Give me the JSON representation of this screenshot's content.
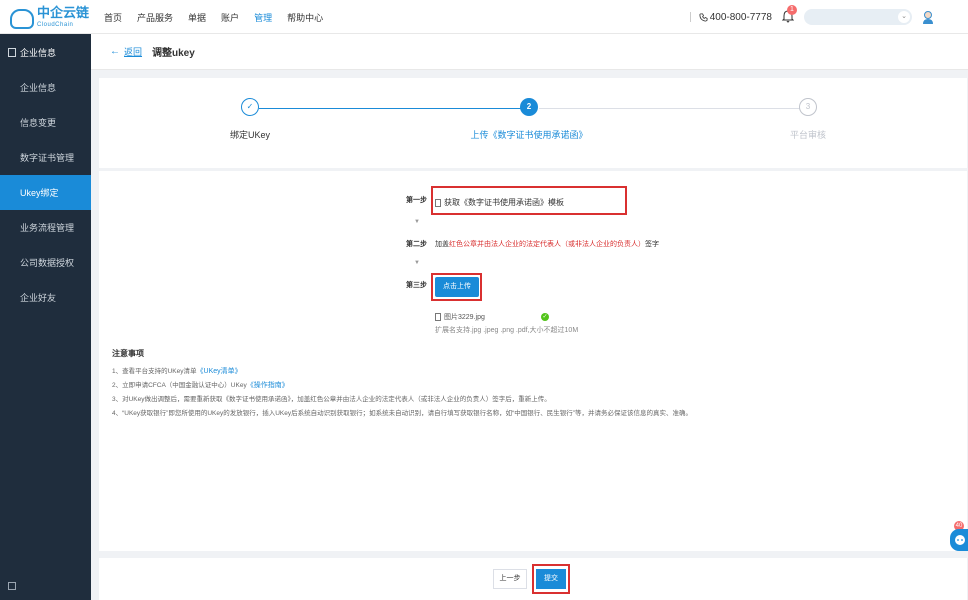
{
  "brand": {
    "name": "中企云链",
    "sub": "CloudChain"
  },
  "nav": {
    "items": [
      "首页",
      "产品服务",
      "单据",
      "账户",
      "管理",
      "帮助中心"
    ],
    "active_index": 4
  },
  "topbar": {
    "phone": "400-800-7778",
    "notification_count": "1",
    "company_select_value": ""
  },
  "sidebar": {
    "header": "企业信息",
    "items": [
      "企业信息",
      "信息变更",
      "数字证书管理",
      "Ukey绑定",
      "业务流程管理",
      "公司数据授权",
      "企业好友"
    ],
    "active_index": 3
  },
  "page": {
    "back_label": "返回",
    "title": "调整ukey"
  },
  "steps": [
    {
      "num": "1",
      "label": "绑定UKey",
      "status": "done"
    },
    {
      "num": "2",
      "label": "上传《数字证书使用承诺函》",
      "status": "active"
    },
    {
      "num": "3",
      "label": "平台审核",
      "status": "pending"
    }
  ],
  "upload": {
    "step1_label": "第一步",
    "step1_link": "获取《数字证书使用承诺函》模板",
    "step2_label": "第二步",
    "step2_pre": "加盖",
    "step2_red": "红色公章并由法人企业的法定代表人（或非法人企业的负责人）",
    "step2_post": "签字",
    "step3_label": "第三步",
    "upload_button": "点击上传",
    "file_name": "图片3229.jpg",
    "hint": "扩展名支持.jpg .jpeg .png .pdf,大小不超过10M"
  },
  "notes": {
    "title": "注意事项",
    "n1_text": "1、查看平台支持的UKey清单",
    "n1_link": "《UKey清单》",
    "n2_text": "2、立即申请CFCA（中国金融认证中心）UKey",
    "n2_link": "《操作指南》",
    "n3": "3、对UKey做出调整后，需要重新获取《数字证书使用承诺函》，加盖红色公章并由法人企业的法定代表人（或非法人企业的负责人）签字后，重新上传。",
    "n4": "4、“UKey获取银行”即您所使用的UKey的发放银行，插入UKey后系统自动识别获取银行；如系统未自动识别，请自行填写获取银行名称，如“中国银行、民生银行”等，并请务必保证该信息的真实、准确。"
  },
  "footer": {
    "prev_label": "上一步",
    "submit_label": "提交"
  },
  "float": {
    "badge": "40"
  },
  "colors": {
    "primary": "#1a8bd8",
    "sidebar_bg": "#1f2d3d",
    "highlight": "#d93030",
    "success": "#52c41a"
  }
}
